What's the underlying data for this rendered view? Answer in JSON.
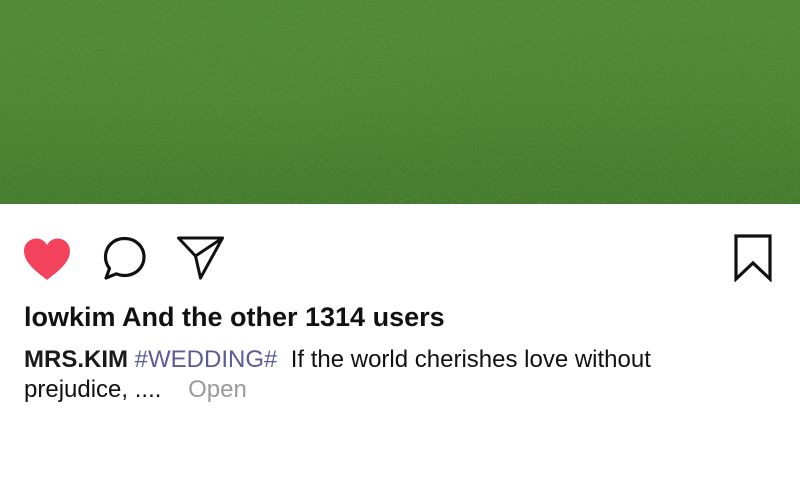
{
  "post": {
    "photo_description": "grass field",
    "liked": true,
    "like_color": "#f2425c",
    "likes_text": "lowkim And the other 1314 users",
    "caption": {
      "author": "MRS.KIM",
      "hashtag": "#WEDDING#",
      "text": "If the world cherishes love without prejudice, ....",
      "more_label": "Open"
    }
  },
  "actions": {
    "icons": [
      "heart-icon",
      "comment-icon",
      "share-icon",
      "bookmark-icon"
    ]
  }
}
